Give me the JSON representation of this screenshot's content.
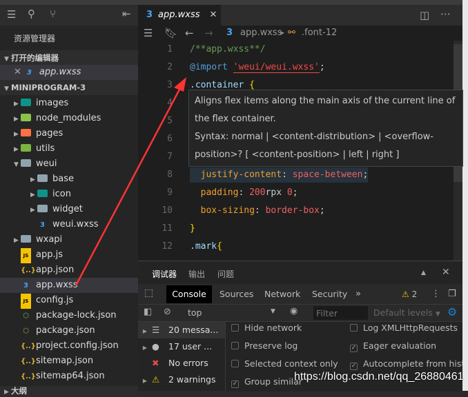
{
  "sidebar": {
    "title": "资源管理器",
    "open_editors_label": "打开的编辑器",
    "open_file": "app.wxss",
    "project_label": "MINIPROGRAM-3",
    "outline_label": "大纲",
    "tree": [
      {
        "label": "images",
        "type": "folder",
        "color": "#0d9488",
        "expanded": false,
        "depth": 0
      },
      {
        "label": "node_modules",
        "type": "folder",
        "color": "#8bc34a",
        "expanded": false,
        "depth": 0
      },
      {
        "label": "pages",
        "type": "folder",
        "color": "#ff7043",
        "expanded": false,
        "depth": 0
      },
      {
        "label": "utils",
        "type": "folder",
        "color": "#7cb342",
        "expanded": false,
        "depth": 0
      },
      {
        "label": "weui",
        "type": "folder-open",
        "color": "#90a4ae",
        "expanded": true,
        "depth": 0
      },
      {
        "label": "base",
        "type": "folder",
        "color": "#90a4ae",
        "expanded": false,
        "depth": 1
      },
      {
        "label": "icon",
        "type": "folder",
        "color": "#0d9488",
        "expanded": false,
        "depth": 1
      },
      {
        "label": "widget",
        "type": "folder",
        "color": "#90a4ae",
        "expanded": false,
        "depth": 1
      },
      {
        "label": "weui.wxss",
        "type": "css",
        "depth": 1
      },
      {
        "label": "wxapi",
        "type": "folder",
        "color": "#90a4ae",
        "expanded": false,
        "depth": 0
      },
      {
        "label": "app.js",
        "type": "js",
        "depth": 0
      },
      {
        "label": "app.json",
        "type": "json",
        "depth": 0
      },
      {
        "label": "app.wxss",
        "type": "css",
        "depth": 0,
        "selected": true
      },
      {
        "label": "config.js",
        "type": "js",
        "depth": 0
      },
      {
        "label": "package-lock.json",
        "type": "node",
        "depth": 0
      },
      {
        "label": "package.json",
        "type": "node",
        "depth": 0
      },
      {
        "label": "project.config.json",
        "type": "json",
        "depth": 0
      },
      {
        "label": "sitemap.json",
        "type": "json",
        "depth": 0
      },
      {
        "label": "sitemap64.json",
        "type": "json",
        "depth": 0
      }
    ]
  },
  "editor": {
    "tab_label": "app.wxss",
    "breadcrumb_file": "app.wxss",
    "breadcrumb_symbol": ".font-12",
    "lines": [
      {
        "n": "1",
        "tokens": [
          {
            "t": "/**app.wxss**/",
            "c": "#6a9955"
          }
        ]
      },
      {
        "n": "2",
        "tokens": [
          {
            "t": "@import ",
            "c": "#569cd6"
          },
          {
            "t": "'weui/weui.wxss'",
            "c": "#f44747"
          },
          {
            "t": ";",
            "c": "#ccc"
          }
        ]
      },
      {
        "n": "3",
        "tokens": [
          {
            "t": ".container ",
            "c": "#9cdcfe"
          },
          {
            "t": "{",
            "c": "#ffd700"
          }
        ]
      },
      {
        "n": "4",
        "tokens": []
      },
      {
        "n": "5",
        "tokens": []
      },
      {
        "n": "6",
        "tokens": []
      },
      {
        "n": "7",
        "tokens": []
      },
      {
        "n": "8",
        "tokens": [
          {
            "t": "  justify-content",
            "c": "#f0a030"
          },
          {
            "t": ": ",
            "c": "#ccc"
          },
          {
            "t": "space-between",
            "c": "#f06060"
          },
          {
            "t": ";",
            "c": "#ccc"
          }
        ]
      },
      {
        "n": "9",
        "tokens": [
          {
            "t": "  padding",
            "c": "#f0a030"
          },
          {
            "t": ": ",
            "c": "#ccc"
          },
          {
            "t": "200",
            "c": "#f06060"
          },
          {
            "t": "rpx ",
            "c": "#ccc"
          },
          {
            "t": "0",
            "c": "#f06060"
          },
          {
            "t": ";",
            "c": "#ccc"
          }
        ]
      },
      {
        "n": "10",
        "tokens": [
          {
            "t": "  box-sizing",
            "c": "#f0a030"
          },
          {
            "t": ": ",
            "c": "#ccc"
          },
          {
            "t": "border-box",
            "c": "#f06060"
          },
          {
            "t": ";",
            "c": "#ccc"
          }
        ]
      },
      {
        "n": "11",
        "tokens": [
          {
            "t": "}",
            "c": "#ffd700"
          }
        ]
      },
      {
        "n": "12",
        "tokens": [
          {
            "t": ".mark",
            "c": "#9cdcfe"
          },
          {
            "t": "{",
            "c": "#ffd700"
          }
        ]
      }
    ],
    "tooltip": {
      "description": "Aligns flex items along the main axis of the current line of the flex container.",
      "syntax": "Syntax: normal | <content-distribution> | <overflow-position>? [ <content-position> | left | right ]"
    }
  },
  "panel": {
    "tabs": [
      "调试器",
      "输出",
      "问题"
    ],
    "devtools_tabs": [
      "Console",
      "Sources",
      "Network",
      "Security"
    ],
    "warning_count": "2",
    "context": "top",
    "filter_placeholder": "Filter",
    "levels": "Default levels",
    "sidebar_items": [
      {
        "label": "20 messa...",
        "icon": "list-icon"
      },
      {
        "label": "17 user ...",
        "icon": "user-icon"
      },
      {
        "label": "No errors",
        "icon": "error-icon"
      },
      {
        "label": "2 warnings",
        "icon": "warning-icon"
      }
    ],
    "options_left": [
      {
        "label": "Hide network",
        "checked": false
      },
      {
        "label": "Preserve log",
        "checked": false
      },
      {
        "label": "Selected context only",
        "checked": false
      },
      {
        "label": "Group similar",
        "checked": true
      }
    ],
    "options_right": [
      {
        "label": "Log XMLHttpRequests",
        "checked": false
      },
      {
        "label": "Eager evaluation",
        "checked": true
      },
      {
        "label": "Autocomplete from history",
        "checked": true
      }
    ]
  },
  "watermark": "https://blog.csdn.net/qq_26880461",
  "colors": {
    "accent": "#0e70c0",
    "arrow": "#ff3333",
    "css_icon": "#42a5f5"
  }
}
